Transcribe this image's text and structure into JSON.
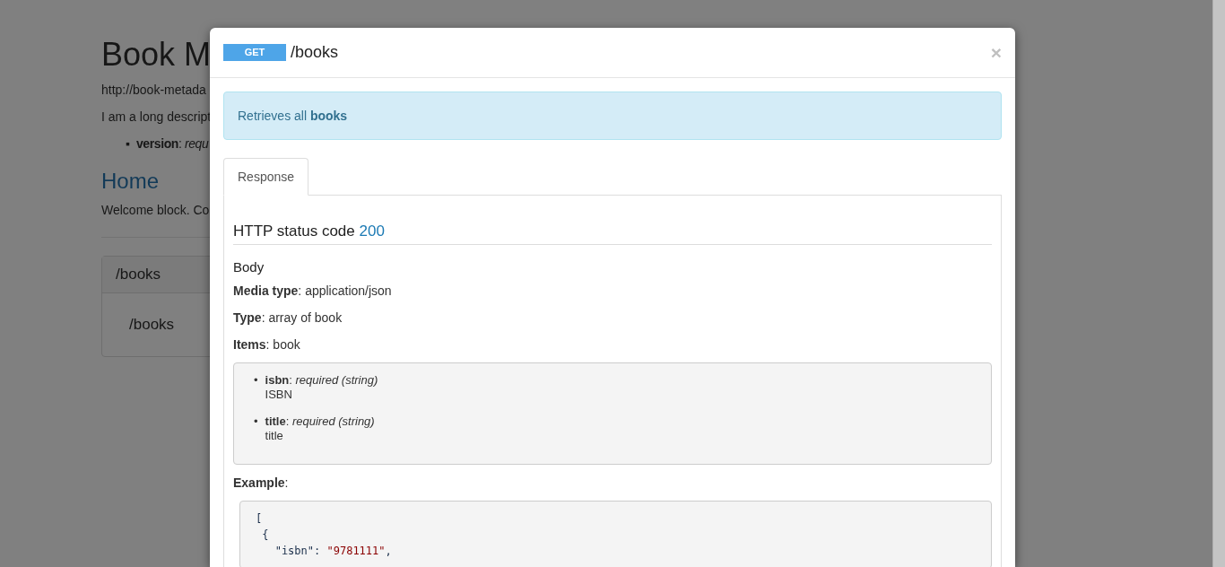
{
  "background_page": {
    "title": "Book M",
    "base_uri": "http://book-metada",
    "description": "I am a long descript",
    "parameters": [
      {
        "marker": "▪",
        "text": "**version**: *requ*"
      }
    ],
    "section_title": "Home",
    "section_text": "Welcome block. Co",
    "resource_panel": {
      "heading": "/books",
      "path": "/books"
    }
  },
  "modal": {
    "method": "GET",
    "path": "/books",
    "close": "×",
    "description": "Retrieves all **books**",
    "tabs": [
      {
        "label": "Response",
        "selected": true
      }
    ],
    "status_label": "HTTP status code",
    "status_code": "200",
    "body_title": "Body",
    "fields": [
      "**Media type**: application/json",
      "**Type**: array of book",
      "**Items**: book"
    ],
    "properties": [
      {
        "marker": "•",
        "title": "**isbn**: *required (string)*",
        "description": "ISBN"
      },
      {
        "marker": "•",
        "title": "**title**: *required (string)*",
        "description": "title"
      }
    ],
    "example_label": "**Example**:",
    "example_lines": [
      [
        {
          "kind": "plain",
          "text": "["
        }
      ],
      [
        {
          "kind": "plain",
          "text": " {"
        }
      ],
      [
        {
          "kind": "plain",
          "text": "   \"isbn\": "
        },
        {
          "kind": "string",
          "text": "\"9781111\""
        },
        {
          "kind": "plain",
          "text": ","
        }
      ]
    ]
  }
}
